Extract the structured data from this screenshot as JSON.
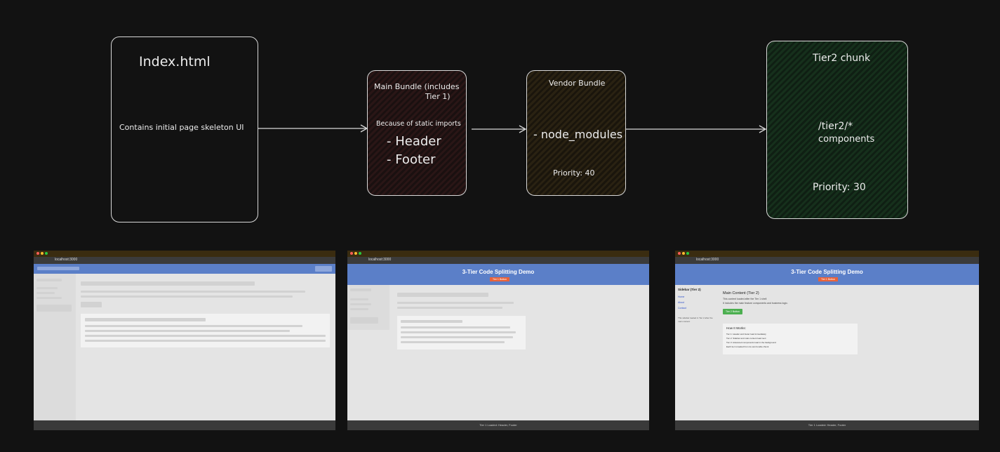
{
  "diagram": {
    "index_box": {
      "title": "Index.html",
      "desc": "Contains initial page skeleton UI"
    },
    "main_bundle": {
      "title_line1": "Main Bundle (includes",
      "title_line2": "Tier 1)",
      "desc": "Because of static imports",
      "item1": "- Header",
      "item2": "- Footer"
    },
    "vendor_bundle": {
      "title": "Vendor Bundle",
      "item": "- node_modules",
      "priority": "Priority: 40"
    },
    "tier2_chunk": {
      "title": "Tier2 chunk",
      "path_line1": "/tier2/*",
      "path_line2": "components",
      "priority": "Priority: 30"
    }
  },
  "screenshots": {
    "shot1": {
      "url": "localhost:3000"
    },
    "shot2": {
      "url": "localhost:3000",
      "app_title": "3-Tier Code Splitting Demo",
      "app_button": "Tier 1 Button",
      "status": "Tier 1 Loaded: Header, Footer"
    },
    "shot3": {
      "url": "localhost:3000",
      "app_title": "3-Tier Code Splitting Demo",
      "app_button": "Tier 1 Button",
      "sidebar_title": "Sidebar (Tier 2)",
      "sidebar_links": [
        "Home",
        "About",
        "Contact"
      ],
      "sidebar_note": "This sidebar loaded in Tier 2 after the main content",
      "main_title": "Main Content (Tier 2)",
      "main_line1": "This content loaded after the Tier 1 shell",
      "main_line2": "It includes the main feature components and business logic.",
      "main_button": "Tier 2 Button",
      "how_title": "How It Works:",
      "how_items": [
        "Tier 1: Header and footer load immediately",
        "Tier 2: Sidebar and main content load next",
        "Tier 3: Advanced components load in the background",
        "Each tier is loaded from its own bundle chunk"
      ],
      "status": "Tier 1 Loaded: Header, Footer"
    }
  }
}
